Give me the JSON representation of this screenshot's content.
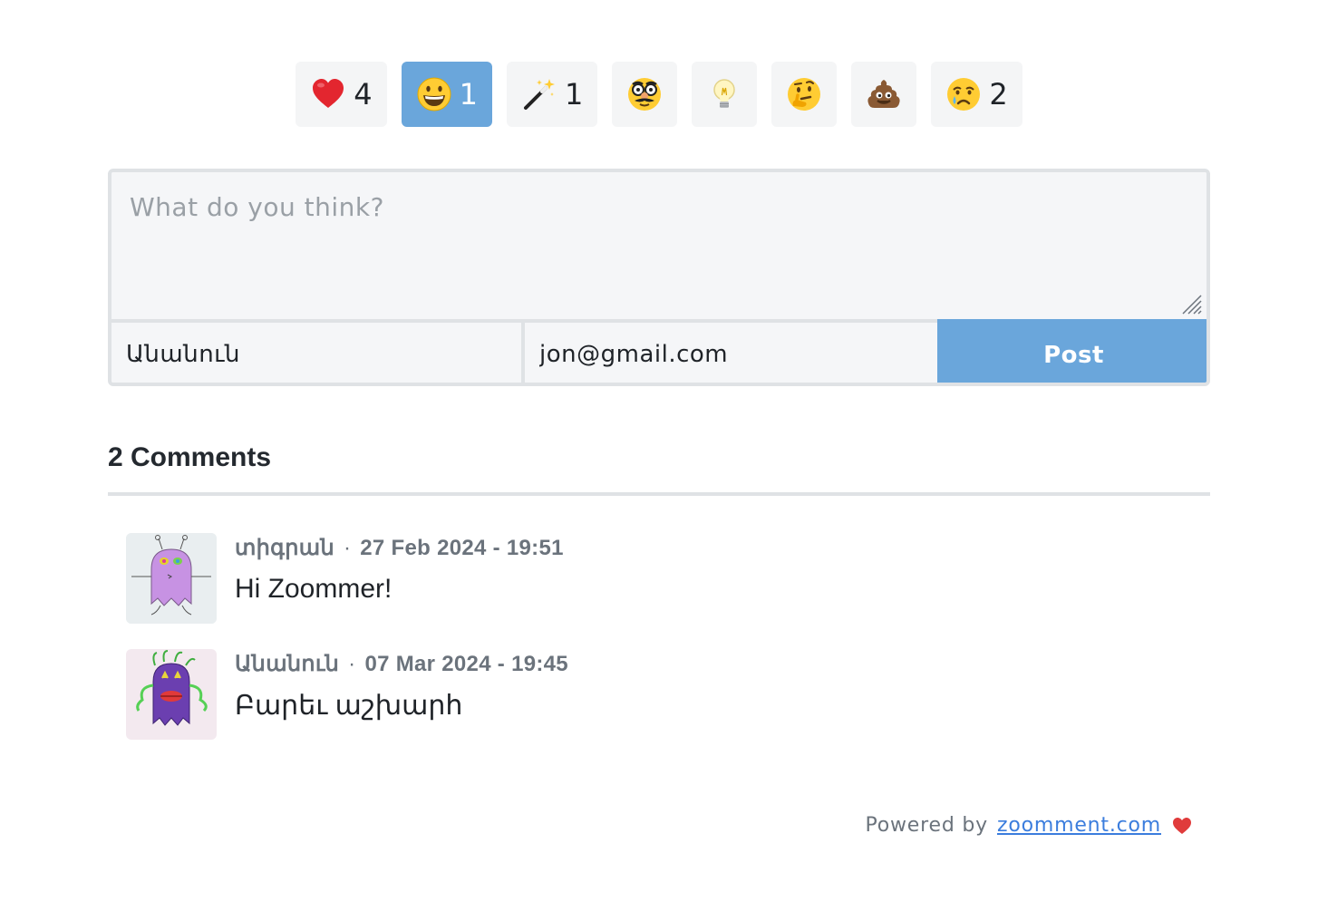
{
  "reactions": [
    {
      "icon": "heart-icon",
      "count": "4",
      "active": false
    },
    {
      "icon": "grinning-face-icon",
      "count": "1",
      "active": true
    },
    {
      "icon": "magic-wand-icon",
      "count": "1",
      "active": false
    },
    {
      "icon": "disguised-face-icon",
      "count": "",
      "active": false
    },
    {
      "icon": "light-bulb-icon",
      "count": "",
      "active": false
    },
    {
      "icon": "thinking-face-icon",
      "count": "",
      "active": false
    },
    {
      "icon": "poop-icon",
      "count": "",
      "active": false
    },
    {
      "icon": "crying-face-icon",
      "count": "2",
      "active": false
    }
  ],
  "form": {
    "placeholder": "What do you think?",
    "name_value": "Անանուն",
    "email_value": "jon@gmail.com",
    "post_label": "Post"
  },
  "comments_header": "2 Comments",
  "comments": [
    {
      "author": "տիգրան",
      "date": "27 Feb 2024 - 19:51",
      "text": "Hi Zoommer!"
    },
    {
      "author": "Անանուն",
      "date": "07 Mar 2024 - 19:45",
      "text": "Բարեւ աշխարհ"
    }
  ],
  "footer": {
    "powered_label": "Powered by",
    "link_text": "zoomment.com"
  },
  "colors": {
    "accent": "#6aa6db",
    "reaction_bg": "#f4f5f6",
    "border": "#dfe2e5",
    "link": "#3b7ddd",
    "heart": "#e03b3b"
  }
}
